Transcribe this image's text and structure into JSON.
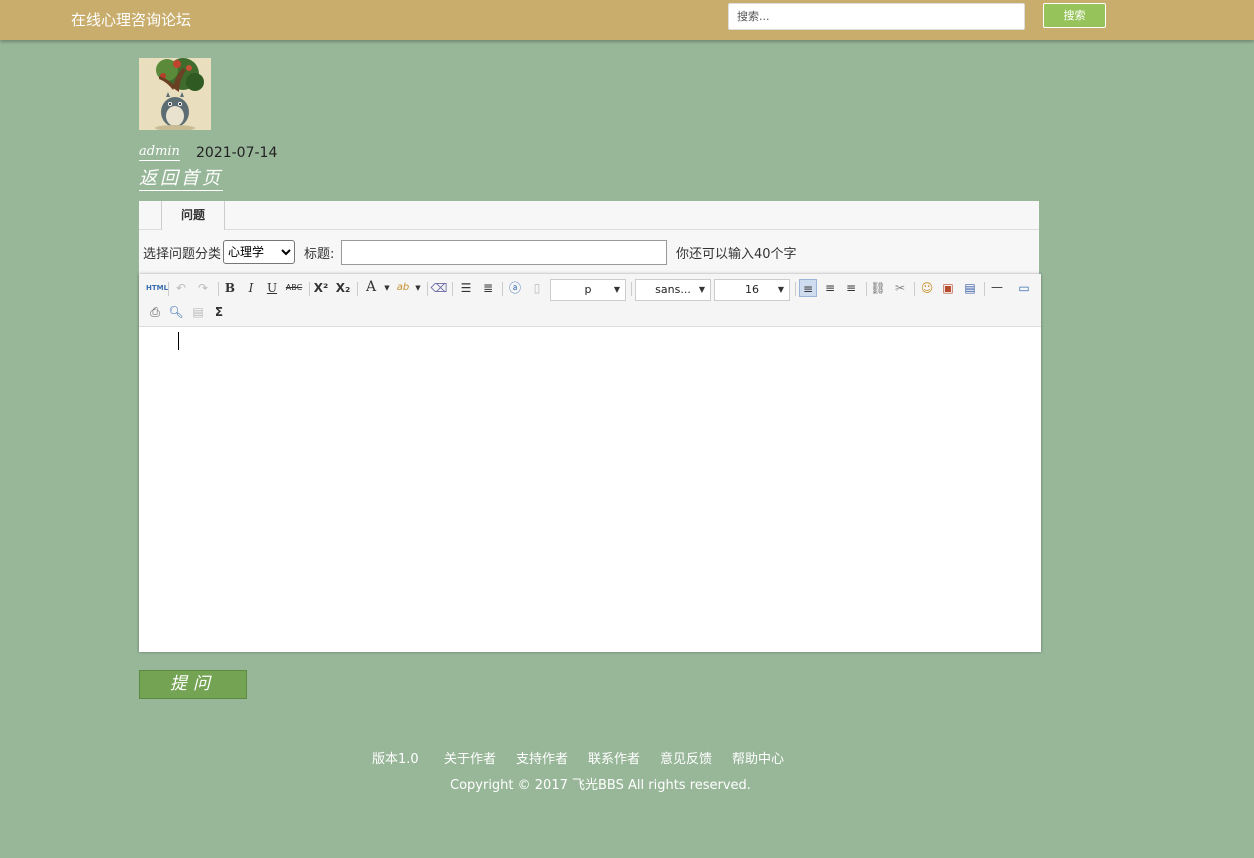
{
  "header": {
    "site_title": "在线心理咨询论坛",
    "search_placeholder": "搜索...",
    "search_button": "搜索"
  },
  "post": {
    "author": "admin",
    "date": "2021-07-14",
    "back_home": "返回首页"
  },
  "form": {
    "tab_label": "问题",
    "category_label": "选择问题分类",
    "category_value": "心理学",
    "title_label": "标题:",
    "title_value": "",
    "char_hint": "你还可以输入40个字"
  },
  "editor": {
    "paragraph_format": "p",
    "font_family": "sans...",
    "font_size": "16",
    "html_icon_text": "HTML"
  },
  "ask_button": "提问",
  "footer": {
    "links": [
      "版本1.0",
      "关于作者",
      "支持作者",
      "联系作者",
      "意见反馈",
      "帮助中心"
    ],
    "copyright": "Copyright © 2017 飞光BBS All rights reserved."
  }
}
